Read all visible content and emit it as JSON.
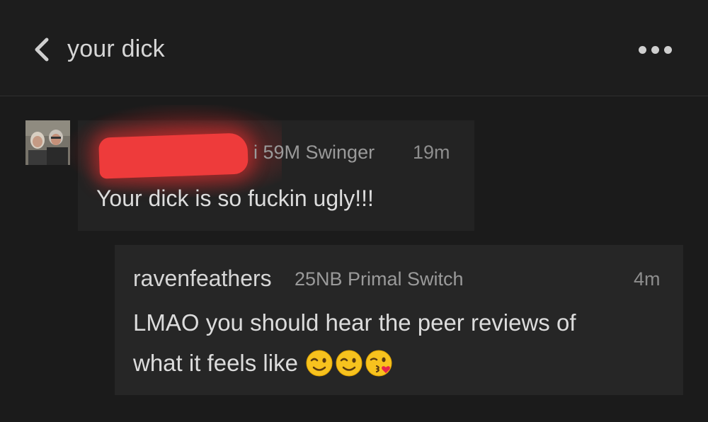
{
  "header": {
    "title": "your dick",
    "back_icon": "chevron-left-icon",
    "more_icon": "more-dots-icon"
  },
  "comment": {
    "meta": "i 59M Swinger",
    "time": "19m",
    "text": "Your dick is so fuckin ugly!!!"
  },
  "reply": {
    "username": "ravenfeathers",
    "meta": "25NB Primal Switch",
    "time": "4m",
    "line1": "LMAO you should hear the peer reviews of",
    "line2": "what it feels like",
    "emojis": [
      "winking-face",
      "winking-face",
      "face-blowing-a-kiss"
    ]
  },
  "colors": {
    "background": "#1b1b1b",
    "card": "#232323",
    "reply_card": "#262626",
    "redaction": "#ee3b3b"
  }
}
